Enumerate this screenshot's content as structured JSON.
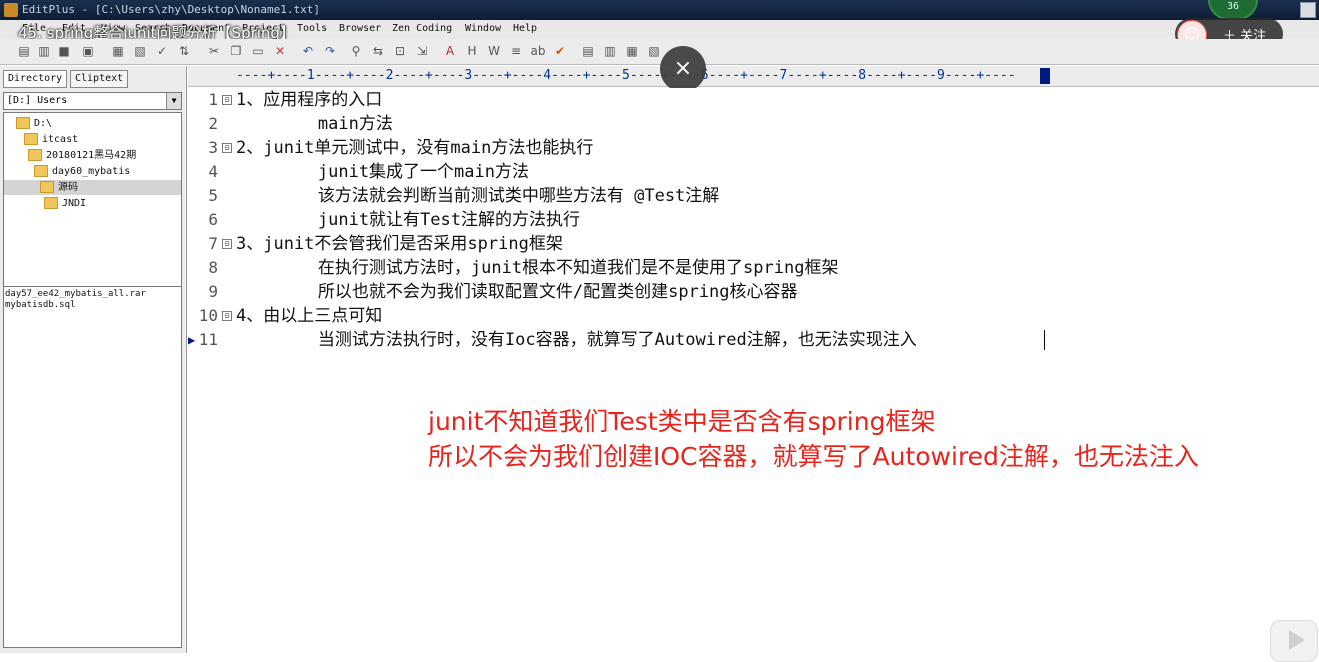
{
  "window": {
    "title": "EditPlus - [C:\\Users\\zhy\\Desktop\\Noname1.txt]"
  },
  "video": {
    "title": "45. spring整合junit问题分析【Spring】",
    "badge": "36",
    "follow_label": "＋ 关注",
    "close": "×"
  },
  "menu": [
    "File",
    "Edit",
    "View",
    "Search",
    "Document",
    "Project",
    "Tools",
    "Browser",
    "Zen Coding",
    "Window",
    "Help"
  ],
  "sidebar": {
    "tabs": [
      "Directory",
      "Cliptext"
    ],
    "drive": "[D:] Users",
    "tree": [
      "D:\\",
      "itcast",
      "20180121黑马42期",
      "day60_mybatis",
      "源码",
      "JNDI"
    ],
    "files": [
      "day57_ee42_mybatis_all.rar",
      "mybatisdb.sql"
    ]
  },
  "ruler": "----+----1----+----2----+----3----+----4----+----5----+----6----+----7----+----8----+----9----+----",
  "editor": {
    "lines": [
      {
        "num": "1",
        "fold": "⊟",
        "text": "1、应用程序的入口"
      },
      {
        "num": "2",
        "fold": "",
        "text": "        main方法"
      },
      {
        "num": "3",
        "fold": "⊟",
        "text": "2、junit单元测试中，没有main方法也能执行"
      },
      {
        "num": "4",
        "fold": "",
        "text": "        junit集成了一个main方法"
      },
      {
        "num": "5",
        "fold": "",
        "text": "        该方法就会判断当前测试类中哪些方法有 @Test注解"
      },
      {
        "num": "6",
        "fold": "",
        "text": "        junit就让有Test注解的方法执行"
      },
      {
        "num": "7",
        "fold": "⊟",
        "text": "3、junit不会管我们是否采用spring框架"
      },
      {
        "num": "8",
        "fold": "",
        "text": "        在执行测试方法时，junit根本不知道我们是不是使用了spring框架"
      },
      {
        "num": "9",
        "fold": "",
        "text": "        所以也就不会为我们读取配置文件/配置类创建spring核心容器"
      },
      {
        "num": "10",
        "fold": "⊟",
        "text": "4、由以上三点可知"
      },
      {
        "num": "11",
        "fold": "",
        "text": "        当测试方法执行时，没有Ioc容器，就算写了Autowired注解，也无法实现注入"
      }
    ]
  },
  "annotation": {
    "line1": "junit不知道我们Test类中是否含有spring框架",
    "line2": "所以不会为我们创建IOC容器，就算写了Autowired注解，也无法注入"
  },
  "colors": {
    "annotation": "#e8241c",
    "ruler": "#00328f"
  }
}
